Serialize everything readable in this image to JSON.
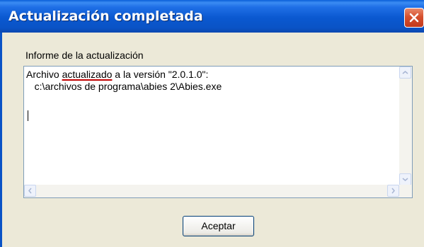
{
  "window": {
    "title": "Actualización completada"
  },
  "group": {
    "label": "Informe de la actualización"
  },
  "report": {
    "line1_prefix": "Archivo ",
    "line1_highlight": "actualizado",
    "line1_suffix": " a la versión \"2.0.1.0\":",
    "line2": "   c:\\archivos de programa\\abies 2\\Abies.exe"
  },
  "buttons": {
    "ok_label": "Aceptar"
  },
  "icons": {
    "close": "close-icon",
    "scroll_up": "chevron-up-icon",
    "scroll_down": "chevron-down-icon",
    "scroll_left": "chevron-left-icon",
    "scroll_right": "chevron-right-icon"
  },
  "colors": {
    "titlebar": "#0a53c6",
    "close_button": "#d6502e",
    "dialog_bg": "#ece9d8",
    "underline": "#c00000"
  }
}
